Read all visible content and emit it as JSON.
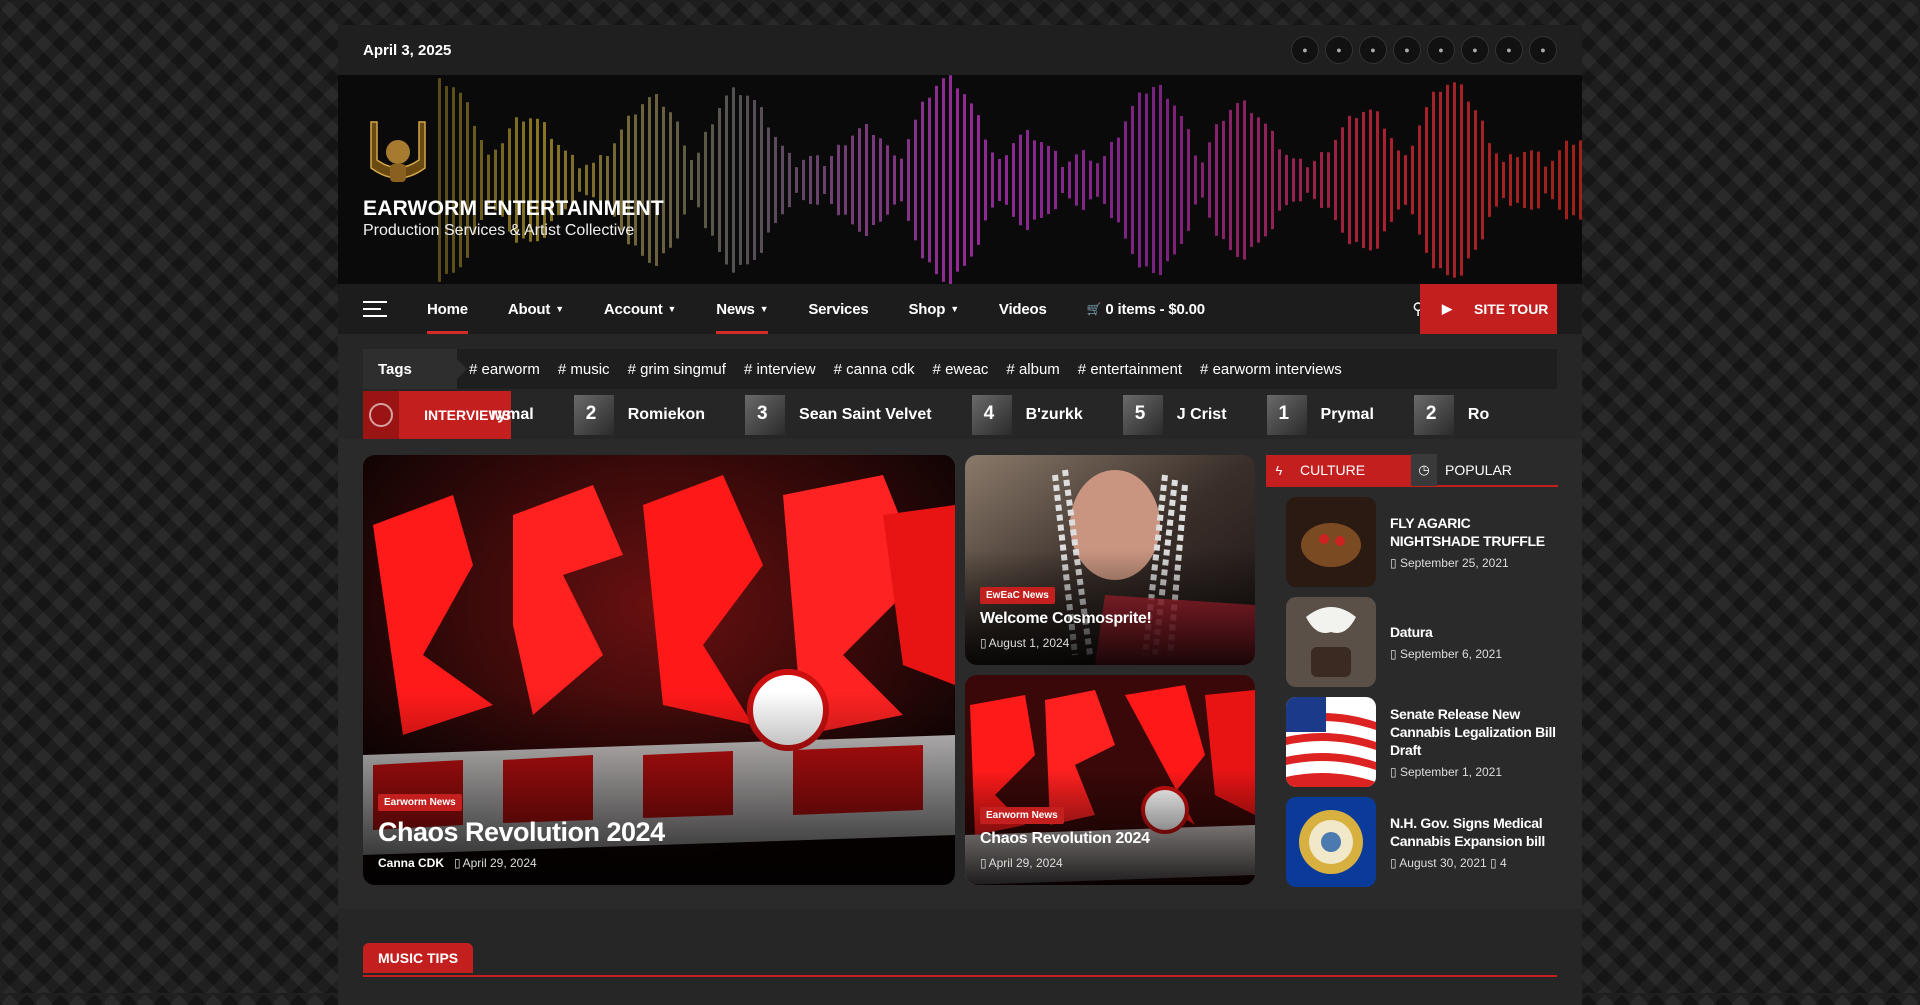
{
  "topbar": {
    "date": "April 3, 2025"
  },
  "brand": {
    "name": "EARWORM ENTERTAINMENT",
    "tagline": "Production Services & Artist Collective"
  },
  "nav": {
    "items": [
      {
        "label": "Home",
        "caret": false,
        "active": true
      },
      {
        "label": "About",
        "caret": true
      },
      {
        "label": "Account",
        "caret": true
      },
      {
        "label": "News",
        "caret": true,
        "active": true
      },
      {
        "label": "Services",
        "caret": false
      },
      {
        "label": "Shop",
        "caret": true
      },
      {
        "label": "Videos",
        "caret": false
      },
      {
        "label": "0 items - $0.00",
        "caret": false
      }
    ],
    "tour_label": "SITE TOUR"
  },
  "tags": {
    "label": "Tags",
    "items": [
      "earworm",
      "music",
      "grim singmuf",
      "interview",
      "canna cdk",
      "eweac",
      "album",
      "entertainment",
      "earworm interviews"
    ]
  },
  "ticker": {
    "label": "INTERVIEWS",
    "items": [
      {
        "num": "",
        "name": "rymal"
      },
      {
        "num": "2",
        "name": "Romiekon"
      },
      {
        "num": "3",
        "name": "Sean Saint Velvet"
      },
      {
        "num": "4",
        "name": "B'zurkk"
      },
      {
        "num": "5",
        "name": "J Crist"
      },
      {
        "num": "1",
        "name": "Prymal"
      },
      {
        "num": "2",
        "name": "Ro"
      }
    ]
  },
  "hero": {
    "badge": "Earworm News",
    "title": "Chaos Revolution 2024",
    "author": "Canna CDK",
    "date": "April 29, 2024"
  },
  "card1": {
    "badge": "EwEaC News",
    "title": "Welcome Cosmosprite!",
    "date": "August 1, 2024"
  },
  "card2": {
    "badge": "Earworm News",
    "title": "Chaos Revolution 2024",
    "date": "April 29, 2024"
  },
  "sidebar": {
    "tab1": "CULTURE",
    "tab2": "POPULAR",
    "items": [
      {
        "title": "FLY AGARIC NIGHTSHADE TRUFFLE",
        "date": "September 25, 2021"
      },
      {
        "title": "Datura",
        "date": "September 6, 2021"
      },
      {
        "title": "Senate Release New Cannabis Legalization Bill Draft",
        "date": "September 1, 2021"
      },
      {
        "title": "N.H. Gov. Signs Medical Cannabis Expansion bill",
        "date": "August 30, 2021",
        "comments": "4"
      }
    ]
  },
  "section": {
    "music_tips": "MUSIC TIPS"
  },
  "colors": {
    "accent": "#c41f1f",
    "background": "#262626"
  }
}
